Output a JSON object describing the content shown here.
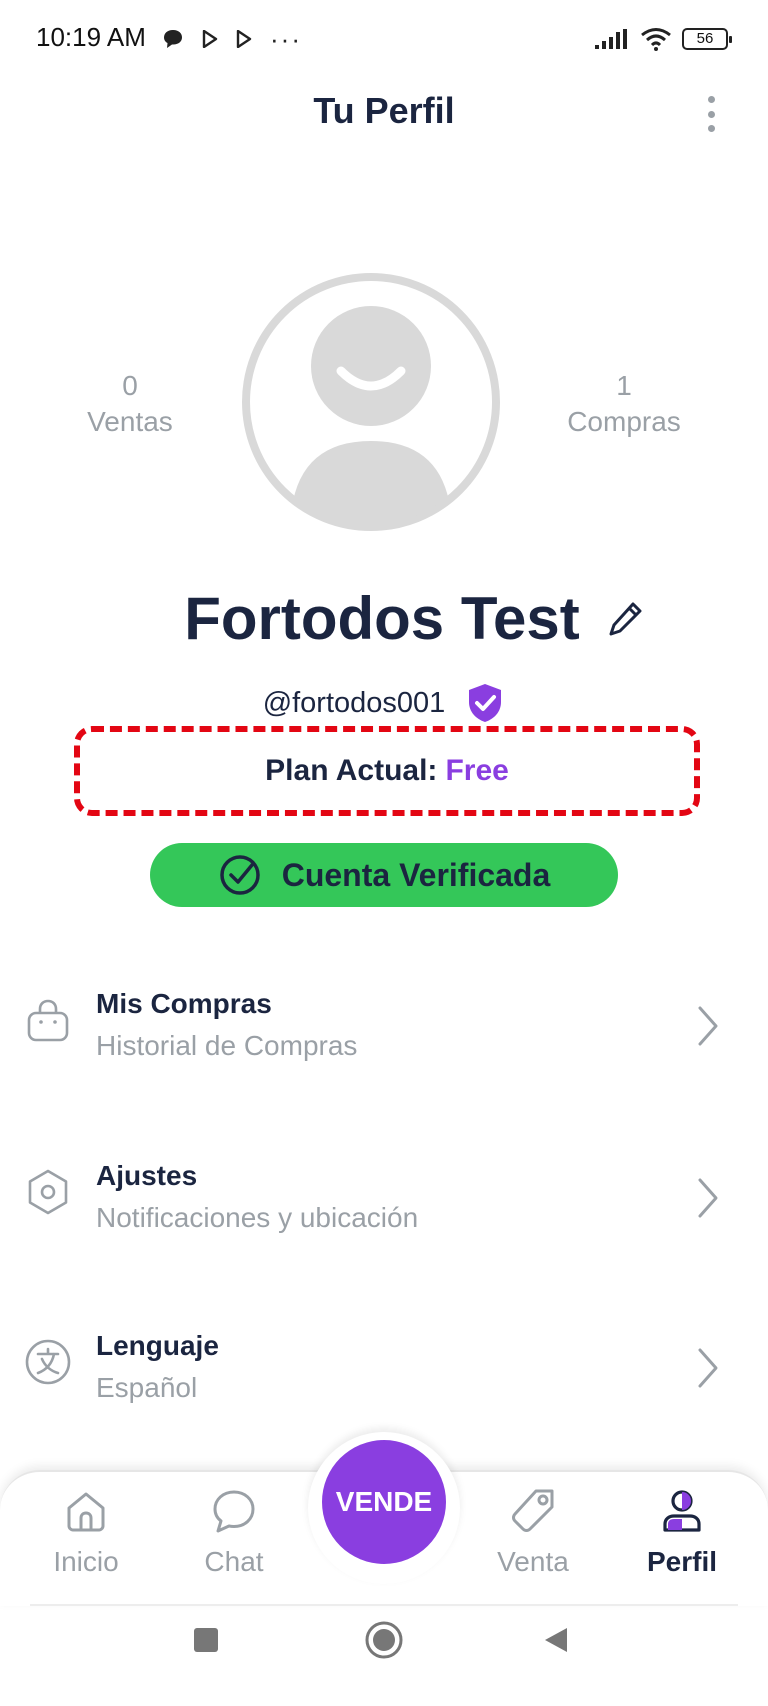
{
  "status_bar": {
    "time": "10:19 AM",
    "notification_icons": [
      "chat-bubble-icon",
      "play-store-icon",
      "play-store-icon",
      "more-dots-icon"
    ],
    "more_dots": "···",
    "battery": "56"
  },
  "header": {
    "title": "Tu Perfil"
  },
  "profile": {
    "sales_count": "0",
    "sales_label": "Ventas",
    "purchases_count": "1",
    "purchases_label": "Compras",
    "name": "Fortodos Test",
    "username": "@fortodos001",
    "plan_label": "Plan Actual:",
    "plan_value": "Free",
    "verified_label": "Cuenta Verificada"
  },
  "menu": [
    {
      "icon": "shopping-bag-icon",
      "title": "Mis Compras",
      "subtitle": "Historial de Compras"
    },
    {
      "icon": "settings-hexagon-icon",
      "title": "Ajustes",
      "subtitle": "Notificaciones y ubicación"
    },
    {
      "icon": "language-icon",
      "title": "Lenguaje",
      "subtitle": "Español"
    }
  ],
  "bottom_nav": {
    "items": [
      {
        "icon": "home-icon",
        "label": "Inicio",
        "active": false
      },
      {
        "icon": "chat-icon",
        "label": "Chat",
        "active": false
      },
      {
        "icon": "tag-icon",
        "label": "Venta",
        "active": false
      },
      {
        "icon": "profile-icon",
        "label": "Perfil",
        "active": true
      }
    ],
    "fab_label": "VENDE"
  },
  "colors": {
    "primary": "#8a3ee0",
    "text_dark": "#1b2540",
    "text_muted": "#9aa0a6",
    "verified_green": "#34c759",
    "highlight_red": "#e30613"
  }
}
